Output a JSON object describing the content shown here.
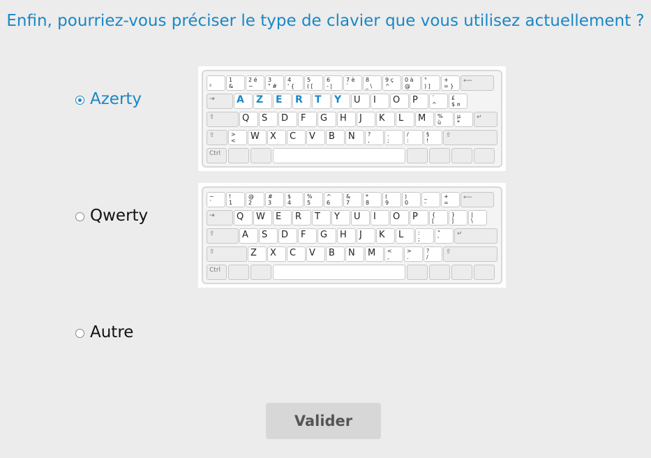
{
  "question": "Enfin, pourriez-vous préciser le type de clavier que vous utilisez actuellement ?",
  "options": [
    {
      "label": "Azerty",
      "selected": true
    },
    {
      "label": "Qwerty",
      "selected": false
    },
    {
      "label": "Autre",
      "selected": false
    }
  ],
  "submit_label": "Valider",
  "accent_color": "#1a87c6",
  "keyboards": {
    "azerty": {
      "number_row": [
        [
          "",
          "²"
        ],
        [
          "1",
          "&"
        ],
        [
          "2 é",
          "~"
        ],
        [
          "3",
          "\" #"
        ],
        [
          "4",
          "' {"
        ],
        [
          "5",
          "( ["
        ],
        [
          "6",
          "- |"
        ],
        [
          "7 è",
          "`"
        ],
        [
          "8",
          "_ \\"
        ],
        [
          "9 ç",
          "^"
        ],
        [
          "0 à",
          "@"
        ],
        [
          "°",
          ") ]"
        ],
        [
          "+",
          "= }"
        ]
      ],
      "row1": [
        "A",
        "Z",
        "E",
        "R",
        "T",
        "Y",
        "U",
        "I",
        "O",
        "P"
      ],
      "row1_extra": [
        [
          "¨",
          "^"
        ],
        [
          "£",
          "$ ¤"
        ]
      ],
      "row2": [
        "Q",
        "S",
        "D",
        "F",
        "G",
        "H",
        "J",
        "K",
        "L",
        "M"
      ],
      "row2_extra": [
        [
          "%",
          "ù"
        ],
        [
          "µ",
          "*"
        ]
      ],
      "row3_lead": [
        ">",
        "<"
      ],
      "row3": [
        "W",
        "X",
        "C",
        "V",
        "B",
        "N"
      ],
      "row3_extra": [
        [
          "?",
          ","
        ],
        [
          ".",
          ";"
        ],
        [
          "/",
          ":"
        ],
        [
          "§",
          "!"
        ]
      ],
      "ctrl": "Ctrl"
    },
    "qwerty": {
      "number_row": [
        [
          "~",
          "`"
        ],
        [
          "!",
          "1"
        ],
        [
          "@",
          "2"
        ],
        [
          "#",
          "3"
        ],
        [
          "$",
          "4"
        ],
        [
          "%",
          "5"
        ],
        [
          "^",
          "6"
        ],
        [
          "&",
          "7"
        ],
        [
          "*",
          "8"
        ],
        [
          "(",
          "9"
        ],
        [
          ")",
          "0"
        ],
        [
          "_",
          "-"
        ],
        [
          "+",
          "="
        ]
      ],
      "row1": [
        "Q",
        "W",
        "E",
        "R",
        "T",
        "Y",
        "U",
        "I",
        "O",
        "P"
      ],
      "row1_extra": [
        [
          "{",
          "["
        ],
        [
          "}",
          "]"
        ],
        [
          "|",
          "\\"
        ]
      ],
      "row2": [
        "A",
        "S",
        "D",
        "F",
        "G",
        "H",
        "J",
        "K",
        "L"
      ],
      "row2_extra": [
        [
          ":",
          ";"
        ],
        [
          "\"",
          "'"
        ]
      ],
      "row3": [
        "Z",
        "X",
        "C",
        "V",
        "B",
        "N",
        "M"
      ],
      "row3_extra": [
        [
          "<",
          ","
        ],
        [
          ">",
          "."
        ],
        [
          "?",
          "/"
        ]
      ],
      "ctrl": "Ctrl"
    }
  }
}
